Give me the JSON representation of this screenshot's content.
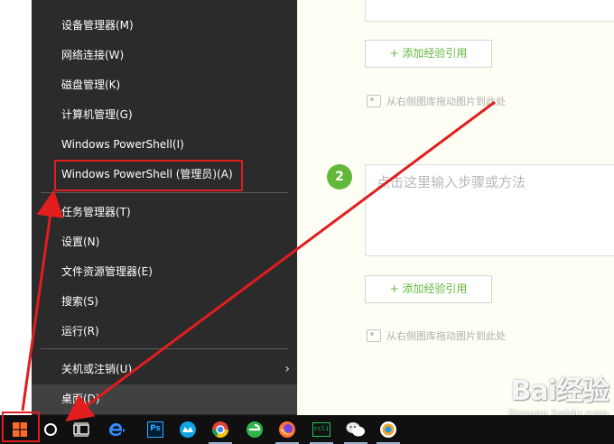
{
  "editor": {
    "step_placeholder": "点击这里输入步骤或方法",
    "step_number": "2",
    "add_ref_label": "+ 添加经验引用",
    "drag_hint": "从右侧图库拖动图片到此处"
  },
  "menu": {
    "items": [
      {
        "label": "设备管理器(M)"
      },
      {
        "label": "网络连接(W)"
      },
      {
        "label": "磁盘管理(K)"
      },
      {
        "label": "计算机管理(G)"
      },
      {
        "label": "Windows PowerShell(I)"
      },
      {
        "label": "Windows PowerShell (管理员)(A)"
      },
      {
        "label": "任务管理器(T)"
      },
      {
        "label": "设置(N)"
      },
      {
        "label": "文件资源管理器(E)"
      },
      {
        "label": "搜索(S)"
      },
      {
        "label": "运行(R)"
      },
      {
        "label": "关机或注销(U)"
      },
      {
        "label": "桌面(D)"
      }
    ],
    "submenu_arrow": "›"
  },
  "taskbar": {
    "icons": [
      "windows-logo-icon",
      "search-circle-icon",
      "task-view-icon",
      "edge-icon",
      "photoshop-icon",
      "chat-app-icon",
      "chrome-icon",
      "360-browser-icon",
      "firefox-icon",
      "terminal-app-icon",
      "wechat-icon",
      "browser-icon"
    ],
    "photoshop_text": "Ps",
    "terminal_text": "rcli"
  },
  "watermark": {
    "logo": "Bai经验",
    "url": "jingyan.baidu.com"
  },
  "colors": {
    "annotation_red": "#e21d1d",
    "accent_green": "#62b83a",
    "menu_bg": "#2b2b2b",
    "taskbar_bg": "#101010"
  }
}
